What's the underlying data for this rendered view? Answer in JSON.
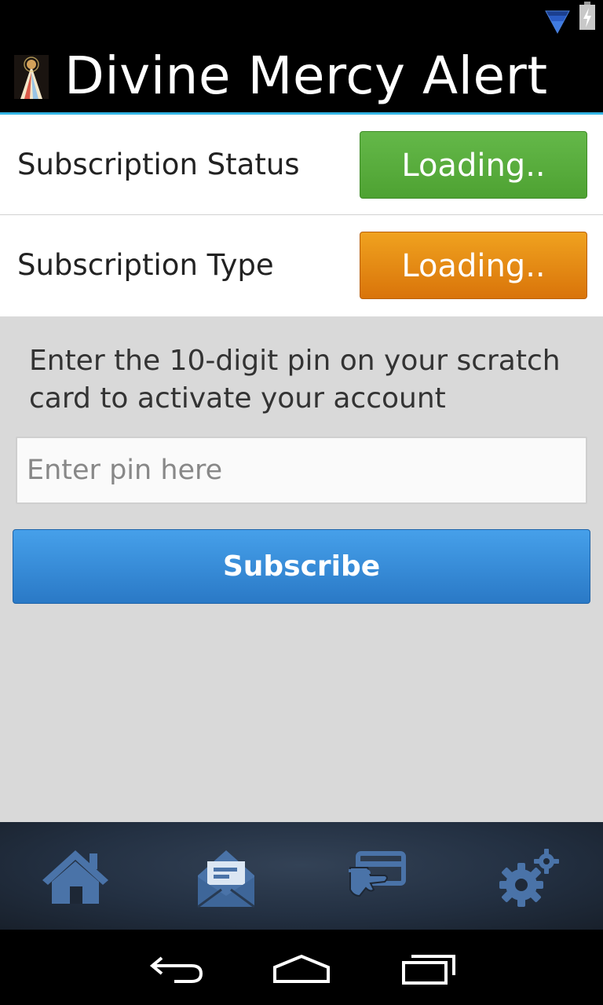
{
  "app_bar": {
    "title": "Divine Mercy Alert",
    "accent": "#33b5e5"
  },
  "subscription": {
    "status_label": "Subscription Status",
    "status_value": "Loading..",
    "status_color": "#5aad3e",
    "type_label": "Subscription Type",
    "type_value": "Loading..",
    "type_color": "#e68c14"
  },
  "activation": {
    "instruction": "Enter the 10-digit pin on your scratch card to activate your account",
    "pin_placeholder": "Enter pin here",
    "pin_value": "",
    "subscribe_label": "Subscribe"
  },
  "bottom_nav": {
    "items": [
      {
        "icon": "home-icon"
      },
      {
        "icon": "messages-icon"
      },
      {
        "icon": "payment-card-icon"
      },
      {
        "icon": "settings-icon"
      }
    ]
  },
  "system_nav": {
    "items": [
      "back-icon",
      "home-icon",
      "recents-icon"
    ]
  }
}
